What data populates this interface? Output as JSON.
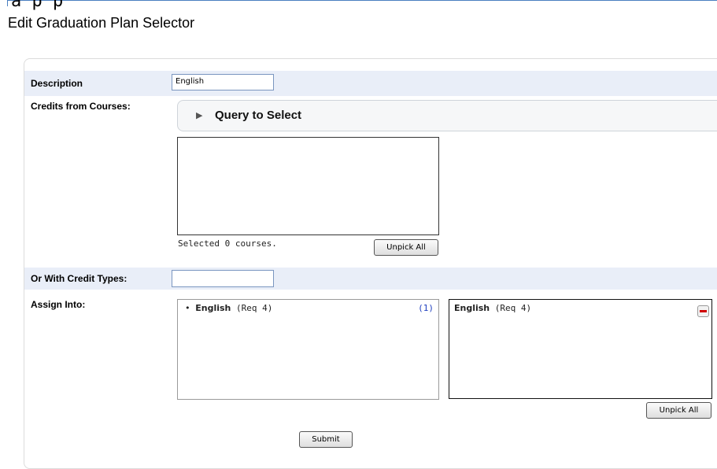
{
  "top_glyph": "a p p",
  "page_title": "Edit Graduation Plan Selector",
  "form": {
    "description_label": "Description",
    "description_value": "English",
    "credits_label": "Credits from Courses:",
    "query_title": "Query to Select",
    "selected_count_text": "Selected 0 courses.",
    "unpick_all_label": "Unpick All",
    "credit_types_label": "Or With Credit Types:",
    "credit_types_value": "",
    "assign_label": "Assign Into:",
    "assign_available": {
      "name": "English",
      "req": "(Req 4)",
      "count": "(1)",
      "bullet": "•"
    },
    "assign_selected": {
      "name": "English",
      "req": "(Req 4)"
    },
    "unpick_all_label_2": "Unpick All",
    "submit_label": "Submit"
  },
  "colors": {
    "row_highlight": "#e9eef8",
    "count_link": "#1f3fbf",
    "remove_icon": "#d00000"
  },
  "icons": {
    "expand": "triangle-right-icon",
    "remove": "minus-icon"
  }
}
